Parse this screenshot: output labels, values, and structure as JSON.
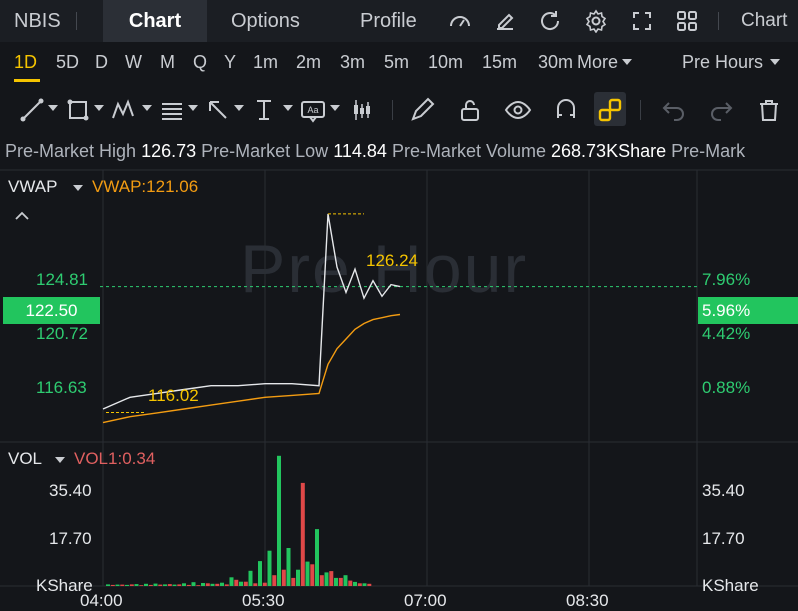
{
  "topbar": {
    "symbol": "NBIS",
    "tabs": [
      {
        "label": "Chart"
      },
      {
        "label": "Options"
      },
      {
        "label": "Profile"
      }
    ],
    "overflow_label": "Chart"
  },
  "periods": {
    "items": [
      "1D",
      "5D",
      "D",
      "W",
      "M",
      "Q",
      "Y",
      "1m",
      "2m",
      "3m",
      "5m",
      "10m",
      "15m",
      "30m"
    ],
    "active": "1D",
    "more_label": "More",
    "session_label": "Pre Hours"
  },
  "premarket": {
    "high_label": "Pre-Market High",
    "high_value": "126.73",
    "low_label": "Pre-Market Low",
    "low_value": "114.84",
    "volume_label": "Pre-Market Volume",
    "volume_value": "268.73KShare",
    "cutoff_label": "Pre-Mark"
  },
  "price_panel": {
    "indicator_name": "VWAP",
    "indicator_value": "VWAP:121.06",
    "watermark": "Pre Hour",
    "left_ticks": [
      "124.81",
      "120.72",
      "116.63"
    ],
    "right_ticks": [
      "7.96%",
      "4.42%",
      "0.88%"
    ],
    "current_price": "122.50",
    "current_pct": "5.96%",
    "high_marker": "126.24",
    "low_marker": "116.02"
  },
  "volume_panel": {
    "indicator_name": "VOL",
    "indicator_value": "VOL1:0.34",
    "left_ticks": [
      "35.40",
      "17.70",
      "KShare"
    ],
    "right_ticks": [
      "35.40",
      "17.70",
      "KShare"
    ]
  },
  "time_axis": [
    "04:00",
    "05:30",
    "07:00",
    "08:30"
  ],
  "colors": {
    "accent": "#f5c400",
    "up": "#22c55e",
    "down": "#e04848",
    "vwap": "#f39c12"
  },
  "chart_data": {
    "type": "line",
    "x": [
      "04:00",
      "04:15",
      "04:30",
      "04:45",
      "05:00",
      "05:15",
      "05:30",
      "05:45",
      "06:00",
      "06:05",
      "06:10",
      "06:15",
      "06:20",
      "06:25",
      "06:30",
      "06:35",
      "06:40",
      "06:45"
    ],
    "series": [
      {
        "values": [
          116.2,
          116.8,
          117.0,
          117.2,
          117.4,
          117.4,
          117.5,
          117.5,
          117.4,
          126.24,
          123.5,
          122.2,
          123.4,
          121.9,
          122.8,
          122.0,
          122.6,
          122.5
        ]
      },
      {
        "name": "VWAP",
        "values": [
          115.5,
          115.8,
          116.0,
          116.2,
          116.4,
          116.6,
          116.8,
          116.9,
          117.0,
          118.5,
          119.3,
          119.8,
          120.3,
          120.6,
          120.8,
          120.9,
          121.0,
          121.06
        ]
      }
    ],
    "volume": {
      "up": [
        0.6,
        0.5,
        0.4,
        0.7,
        0.8,
        0.9,
        0.6,
        0.5,
        1.0,
        1.4,
        1.1,
        0.8,
        1.2,
        3.2,
        1.6,
        5.6,
        9.2,
        13.0,
        48.0,
        14.0,
        6.0,
        9.0,
        21.0,
        5.0,
        3.0,
        4.0,
        1.5,
        1.0
      ],
      "down": [
        0.4,
        0.5,
        0.6,
        0.3,
        0.4,
        0.5,
        0.7,
        0.6,
        0.4,
        0.3,
        1.0,
        0.8,
        0.6,
        2.3,
        1.6,
        1.0,
        1.2,
        4.0,
        6.0,
        3.0,
        38.0,
        8.0,
        4.0,
        5.5,
        3.0,
        2.0,
        1.0,
        0.8
      ]
    },
    "ylim": [
      114.5,
      128.5
    ],
    "vol_ylim": [
      0,
      53.1
    ]
  }
}
